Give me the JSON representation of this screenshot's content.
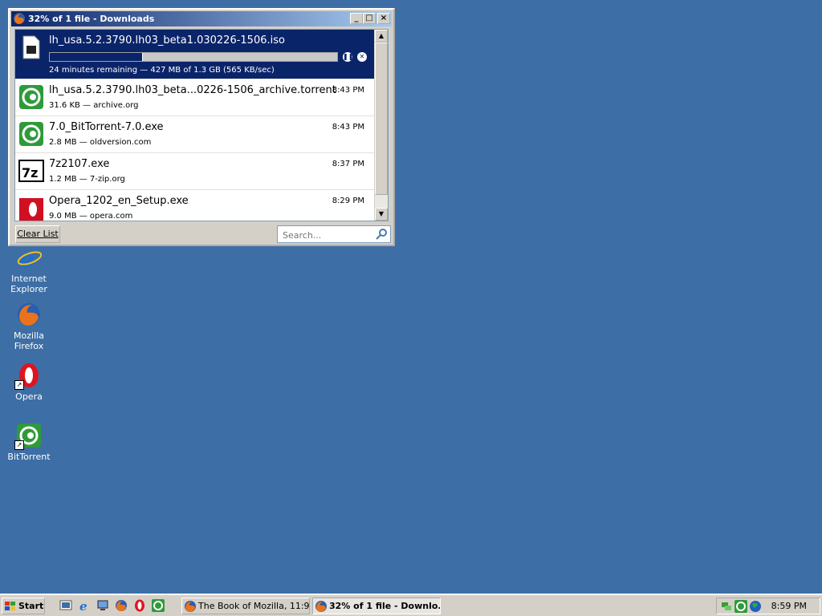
{
  "window": {
    "title": "32% of 1 file - Downloads",
    "minimize": "_",
    "maximize": "□",
    "close": "×"
  },
  "downloads": [
    {
      "name": "lh_usa.5.2.3790.lh03_beta1.030226-1506.iso",
      "status": "24 minutes remaining — 427 MB of 1.3 GB (565 KB/sec)",
      "progress": 0.32,
      "icon": "iso-file-icon"
    },
    {
      "name": "lh_usa.5.2.3790.lh03_beta...0226-1506_archive.torrent",
      "meta": "31.6 KB — archive.org",
      "time": "8:43 PM",
      "icon": "bittorrent-icon"
    },
    {
      "name": "7.0_BitTorrent-7.0.exe",
      "meta": "2.8 MB — oldversion.com",
      "time": "8:43 PM",
      "icon": "bittorrent-icon"
    },
    {
      "name": "7z2107.exe",
      "meta": "1.2 MB — 7-zip.org",
      "time": "8:37 PM",
      "icon": "7zip-icon"
    },
    {
      "name": "Opera_1202_en_Setup.exe",
      "meta": "9.0 MB — opera.com",
      "time": "8:29 PM",
      "icon": "opera-icon"
    }
  ],
  "footer": {
    "clear_label": "Clear List",
    "search_placeholder": "Search..."
  },
  "desktop": {
    "icons": [
      {
        "label": "Internet Explorer"
      },
      {
        "label": "Mozilla Firefox"
      },
      {
        "label": "Opera"
      },
      {
        "label": "BitTorrent"
      }
    ]
  },
  "taskbar": {
    "start": "Start",
    "tasks": [
      {
        "label": "The Book of Mozilla, 11:9 ..."
      },
      {
        "label": "32% of 1 file - Downlo..."
      }
    ],
    "clock": "8:59 PM"
  },
  "colors": {
    "desktop": "#3d6ea5",
    "selection": "#0a246a",
    "chrome": "#d4d0c8"
  }
}
